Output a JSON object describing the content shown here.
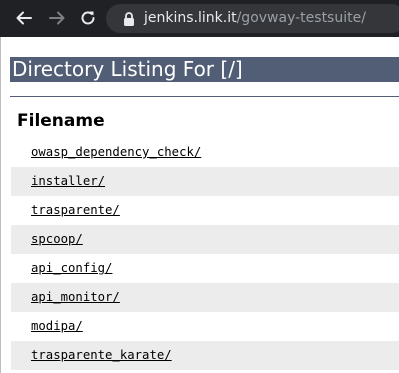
{
  "browser": {
    "url_host": "jenkins.link.it",
    "url_path": "/govway-testsuite/"
  },
  "page": {
    "heading": "Directory Listing For [/]",
    "column_header": "Filename",
    "entries": [
      {
        "name": "owasp_dependency_check/"
      },
      {
        "name": "installer/"
      },
      {
        "name": "trasparente/"
      },
      {
        "name": "spcoop/"
      },
      {
        "name": "api_config/"
      },
      {
        "name": "api_monitor/"
      },
      {
        "name": "modipa/"
      },
      {
        "name": "trasparente_karate/"
      }
    ]
  },
  "colors": {
    "toolbar_bg": "#202124",
    "omnibox_bg": "#35363a",
    "heading_bg": "#525d76",
    "row_shade": "#ececec"
  }
}
